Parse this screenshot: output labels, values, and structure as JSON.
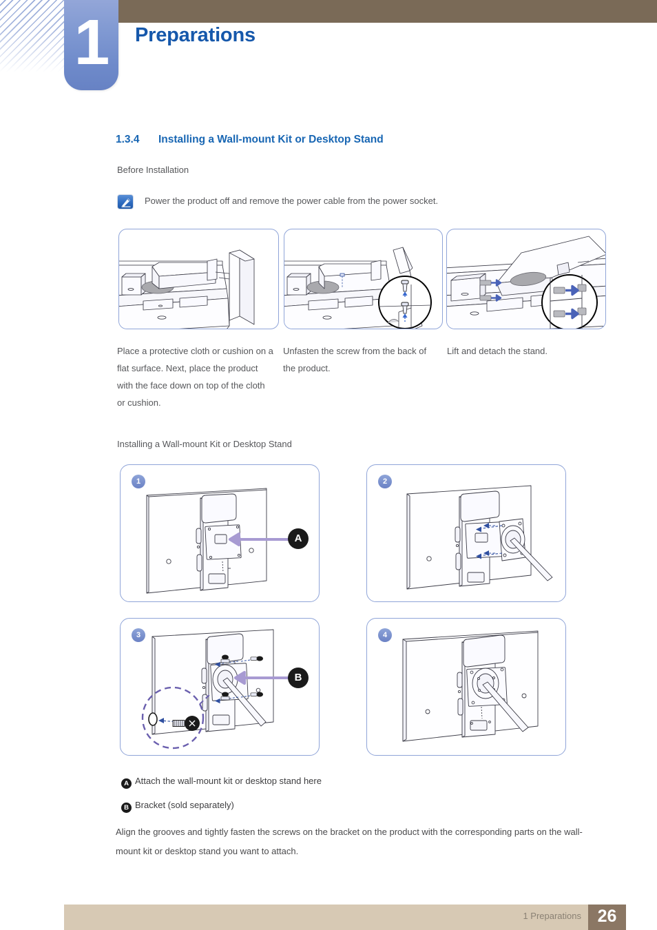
{
  "header": {
    "chapter_number": "1",
    "chapter_title": "Preparations",
    "accent_blue": "#1658ab",
    "tab_blue": "#7a92cd",
    "bar_brown": "#7a6a57"
  },
  "section": {
    "number": "1.3.4",
    "title": "Installing a Wall-mount Kit or Desktop Stand",
    "subheading": "Before Installation",
    "note_icon": "note-pen-icon",
    "note_text": "Power the product off and remove the power cable from the power socket."
  },
  "before_install": {
    "panels": [
      {
        "id": "panel-cloth",
        "caption": "Place a protective cloth or cushion on a flat surface. Next, place the product with the face down on top of the cloth or cushion."
      },
      {
        "id": "panel-unfasten",
        "caption": "Unfasten the screw from the back of the product."
      },
      {
        "id": "panel-detach",
        "caption": "Lift and detach the stand."
      }
    ]
  },
  "install": {
    "subheading": "Installing a Wall-mount Kit or Desktop Stand",
    "steps": [
      {
        "number": "1",
        "marker": "A"
      },
      {
        "number": "2",
        "marker": ""
      },
      {
        "number": "3",
        "marker": "B"
      },
      {
        "number": "4",
        "marker": ""
      }
    ]
  },
  "legend": [
    {
      "badge": "A",
      "text": "Attach the wall-mount kit or desktop stand here"
    },
    {
      "badge": "B",
      "text": "Bracket (sold separately)"
    }
  ],
  "closing_paragraph": "Align the grooves and tightly fasten the screws on the bracket on the product with the corresponding parts on the wall-mount kit or desktop stand you want to attach.",
  "footer": {
    "label": "1 Preparations",
    "page_number": "26",
    "bar_color": "#d7c9b4",
    "page_box_color": "#8b7764"
  }
}
